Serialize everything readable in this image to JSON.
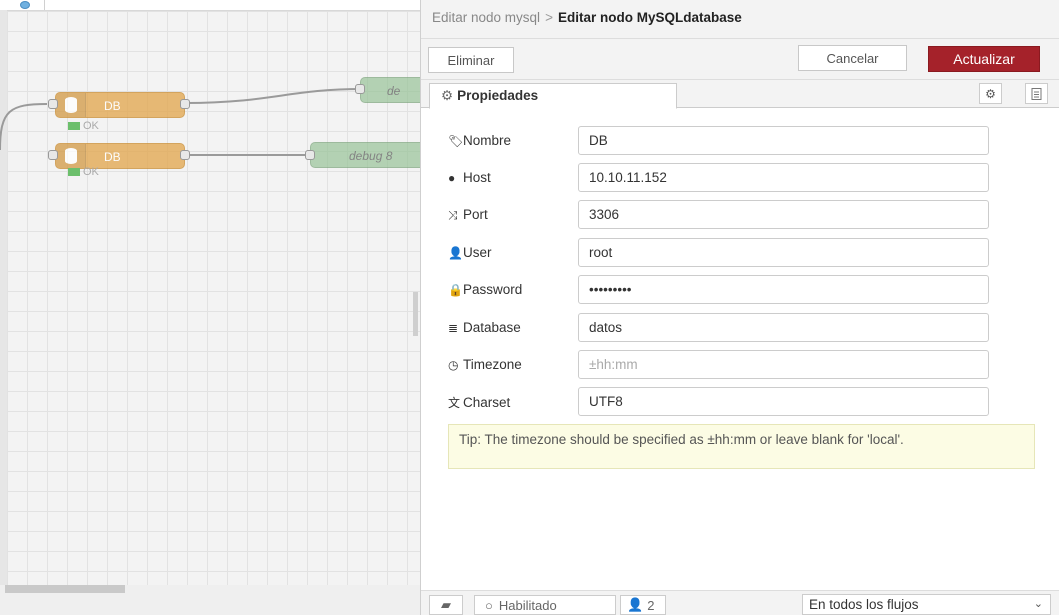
{
  "canvas": {
    "nodes": [
      {
        "label": "DB",
        "status": "OK"
      },
      {
        "label": "DB",
        "status": "OK"
      }
    ],
    "debug_nodes": [
      {
        "label": "de"
      },
      {
        "label": "debug 8"
      }
    ]
  },
  "panel": {
    "breadcrumb_parent": "Editar nodo mysql",
    "breadcrumb_separator": ">",
    "breadcrumb_current": "Editar nodo MySQLdatabase",
    "delete_label": "Eliminar",
    "cancel_label": "Cancelar",
    "update_label": "Actualizar",
    "tab_properties": "Propiedades",
    "fields": [
      {
        "label": "Nombre",
        "icon": "tag-icon",
        "value": "DB",
        "placeholder": ""
      },
      {
        "label": "Host",
        "icon": "globe-icon",
        "value": "10.10.11.152",
        "placeholder": ""
      },
      {
        "label": "Port",
        "icon": "random-icon",
        "value": "3306",
        "placeholder": ""
      },
      {
        "label": "User",
        "icon": "user-icon",
        "value": "root",
        "placeholder": ""
      },
      {
        "label": "Password",
        "icon": "lock-icon",
        "value": "•••••••••",
        "placeholder": ""
      },
      {
        "label": "Database",
        "icon": "database-icon",
        "value": "datos",
        "placeholder": ""
      },
      {
        "label": "Timezone",
        "icon": "clock-icon",
        "value": "",
        "placeholder": "±hh:mm"
      },
      {
        "label": "Charset",
        "icon": "language-icon",
        "value": "UTF8",
        "placeholder": ""
      }
    ],
    "tip": "Tip: The timezone should be specified as ±hh:mm or leave blank for 'local'.",
    "footer": {
      "enabled_label": "Habilitado",
      "users_count": "2",
      "scope_select": "En todos los flujos"
    },
    "colors": {
      "update_button": "#a5222a",
      "node_fill": "#e2a54a",
      "debug_fill": "#98c398"
    }
  }
}
